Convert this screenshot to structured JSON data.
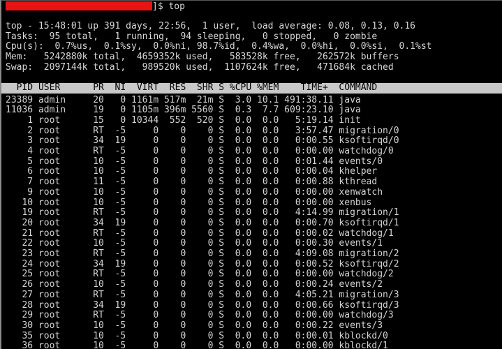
{
  "terminal": {
    "window_title": "top",
    "background_color": "#000000",
    "foreground_color": "#d8d8d8",
    "redaction_color": "#e81313",
    "header_background": "#c8c8c8",
    "header_foreground": "#000000"
  },
  "prompt": {
    "redacted_label": "redacted-prompt",
    "tail": "]$ ",
    "command": "top"
  },
  "summary": {
    "uptime_line": "top - 15:48:01 up 391 days, 22:56,  1 user,  load average: 0.08, 0.13, 0.16",
    "tasks_line": "Tasks:  95 total,   1 running,  94 sleeping,   0 stopped,   0 zombie",
    "cpu_line": "Cpu(s):  0.7%us,  0.1%sy,  0.0%ni, 98.7%id,  0.4%wa,  0.0%hi,  0.0%si,  0.1%st",
    "mem_line": "Mem:   5242880k total,  4659352k used,   583528k free,   262572k buffers",
    "swap_line": "Swap:  2097144k total,   989520k used,  1107624k free,   471684k cached",
    "time": "15:48:01",
    "up_days": "391",
    "up_hm": "22:56",
    "users": "1",
    "load_average": [
      "0.08",
      "0.13",
      "0.16"
    ],
    "tasks": {
      "total": "95",
      "running": "1",
      "sleeping": "94",
      "stopped": "0",
      "zombie": "0"
    },
    "cpu": {
      "us": "0.7",
      "sy": "0.1",
      "ni": "0.0",
      "id": "98.7",
      "wa": "0.4",
      "hi": "0.0",
      "si": "0.0",
      "st": "0.1"
    },
    "mem": {
      "total": "5242880k",
      "used": "4659352k",
      "free": "583528k",
      "buffers": "262572k"
    },
    "swap": {
      "total": "2097144k",
      "used": "989520k",
      "free": "1107624k",
      "cached": "471684k"
    }
  },
  "table": {
    "header_line": "  PID USER      PR  NI  VIRT  RES  SHR S %CPU %MEM    TIME+  COMMAND",
    "columns": [
      "PID",
      "USER",
      "PR",
      "NI",
      "VIRT",
      "RES",
      "SHR",
      "S",
      "%CPU",
      "%MEM",
      "TIME+",
      "COMMAND"
    ],
    "rows": [
      "23389 admin     20   0 1161m 517m  21m S  3.0 10.1 491:38.11 java",
      "11036 admin     19   0 1105m 396m 5560 S  0.3  7.7 609:23.10 java",
      "    1 root      15   0 10344  552  520 S  0.0  0.0   5:19.14 init",
      "    2 root      RT  -5     0    0    0 S  0.0  0.0   3:57.47 migration/0",
      "    3 root      34  19     0    0    0 S  0.0  0.0   0:00.55 ksoftirqd/0",
      "    4 root      RT  -5     0    0    0 S  0.0  0.0   0:00.00 watchdog/0",
      "    5 root      10  -5     0    0    0 S  0.0  0.0   0:01.44 events/0",
      "    6 root      10  -5     0    0    0 S  0.0  0.0   0:00.04 khelper",
      "    7 root      11  -5     0    0    0 S  0.0  0.0   0:00.88 kthread",
      "    9 root      10  -5     0    0    0 S  0.0  0.0   0:00.00 xenwatch",
      "   10 root      10  -5     0    0    0 S  0.0  0.0   0:00.00 xenbus",
      "   19 root      RT  -5     0    0    0 S  0.0  0.0   4:14.99 migration/1",
      "   20 root      34  19     0    0    0 S  0.0  0.0   0:00.70 ksoftirqd/1",
      "   21 root      RT  -5     0    0    0 S  0.0  0.0   0:00.02 watchdog/1",
      "   22 root      10  -5     0    0    0 S  0.0  0.0   0:00.30 events/1",
      "   23 root      RT  -5     0    0    0 S  0.0  0.0   4:09.08 migration/2",
      "   24 root      34  19     0    0    0 S  0.0  0.0   0:00.52 ksoftirqd/2",
      "   25 root      RT  -5     0    0    0 S  0.0  0.0   0:00.00 watchdog/2",
      "   26 root      10  -5     0    0    0 S  0.0  0.0   0:00.24 events/2",
      "   27 root      RT  -5     0    0    0 S  0.0  0.0   4:05.21 migration/3",
      "   28 root      34  19     0    0    0 S  0.0  0.0   0:00.66 ksoftirqd/3",
      "   29 root      RT  -5     0    0    0 S  0.0  0.0   0:00.00 watchdog/3",
      "   30 root      10  -5     0    0    0 S  0.0  0.0   0:00.22 events/3",
      "   35 root      10  -5     0    0    0 S  0.0  0.0   0:00.01 kblockd/0",
      "   36 root      10  -5     0    0    0 S  0.0  0.0   0:00.00 kblockd/1"
    ],
    "processes": [
      {
        "pid": "23389",
        "user": "admin",
        "pr": "20",
        "ni": "0",
        "virt": "1161m",
        "res": "517m",
        "shr": "21m",
        "s": "S",
        "cpu": "3.0",
        "mem": "10.1",
        "time": "491:38.11",
        "command": "java"
      },
      {
        "pid": "11036",
        "user": "admin",
        "pr": "19",
        "ni": "0",
        "virt": "1105m",
        "res": "396m",
        "shr": "5560",
        "s": "S",
        "cpu": "0.3",
        "mem": "7.7",
        "time": "609:23.10",
        "command": "java"
      },
      {
        "pid": "1",
        "user": "root",
        "pr": "15",
        "ni": "0",
        "virt": "10344",
        "res": "552",
        "shr": "520",
        "s": "S",
        "cpu": "0.0",
        "mem": "0.0",
        "time": "5:19.14",
        "command": "init"
      },
      {
        "pid": "2",
        "user": "root",
        "pr": "RT",
        "ni": "-5",
        "virt": "0",
        "res": "0",
        "shr": "0",
        "s": "S",
        "cpu": "0.0",
        "mem": "0.0",
        "time": "3:57.47",
        "command": "migration/0"
      },
      {
        "pid": "3",
        "user": "root",
        "pr": "34",
        "ni": "19",
        "virt": "0",
        "res": "0",
        "shr": "0",
        "s": "S",
        "cpu": "0.0",
        "mem": "0.0",
        "time": "0:00.55",
        "command": "ksoftirqd/0"
      },
      {
        "pid": "4",
        "user": "root",
        "pr": "RT",
        "ni": "-5",
        "virt": "0",
        "res": "0",
        "shr": "0",
        "s": "S",
        "cpu": "0.0",
        "mem": "0.0",
        "time": "0:00.00",
        "command": "watchdog/0"
      },
      {
        "pid": "5",
        "user": "root",
        "pr": "10",
        "ni": "-5",
        "virt": "0",
        "res": "0",
        "shr": "0",
        "s": "S",
        "cpu": "0.0",
        "mem": "0.0",
        "time": "0:01.44",
        "command": "events/0"
      },
      {
        "pid": "6",
        "user": "root",
        "pr": "10",
        "ni": "-5",
        "virt": "0",
        "res": "0",
        "shr": "0",
        "s": "S",
        "cpu": "0.0",
        "mem": "0.0",
        "time": "0:00.04",
        "command": "khelper"
      },
      {
        "pid": "7",
        "user": "root",
        "pr": "11",
        "ni": "-5",
        "virt": "0",
        "res": "0",
        "shr": "0",
        "s": "S",
        "cpu": "0.0",
        "mem": "0.0",
        "time": "0:00.88",
        "command": "kthread"
      },
      {
        "pid": "9",
        "user": "root",
        "pr": "10",
        "ni": "-5",
        "virt": "0",
        "res": "0",
        "shr": "0",
        "s": "S",
        "cpu": "0.0",
        "mem": "0.0",
        "time": "0:00.00",
        "command": "xenwatch"
      },
      {
        "pid": "10",
        "user": "root",
        "pr": "10",
        "ni": "-5",
        "virt": "0",
        "res": "0",
        "shr": "0",
        "s": "S",
        "cpu": "0.0",
        "mem": "0.0",
        "time": "0:00.00",
        "command": "xenbus"
      },
      {
        "pid": "19",
        "user": "root",
        "pr": "RT",
        "ni": "-5",
        "virt": "0",
        "res": "0",
        "shr": "0",
        "s": "S",
        "cpu": "0.0",
        "mem": "0.0",
        "time": "4:14.99",
        "command": "migration/1"
      },
      {
        "pid": "20",
        "user": "root",
        "pr": "34",
        "ni": "19",
        "virt": "0",
        "res": "0",
        "shr": "0",
        "s": "S",
        "cpu": "0.0",
        "mem": "0.0",
        "time": "0:00.70",
        "command": "ksoftirqd/1"
      },
      {
        "pid": "21",
        "user": "root",
        "pr": "RT",
        "ni": "-5",
        "virt": "0",
        "res": "0",
        "shr": "0",
        "s": "S",
        "cpu": "0.0",
        "mem": "0.0",
        "time": "0:00.02",
        "command": "watchdog/1"
      },
      {
        "pid": "22",
        "user": "root",
        "pr": "10",
        "ni": "-5",
        "virt": "0",
        "res": "0",
        "shr": "0",
        "s": "S",
        "cpu": "0.0",
        "mem": "0.0",
        "time": "0:00.30",
        "command": "events/1"
      },
      {
        "pid": "23",
        "user": "root",
        "pr": "RT",
        "ni": "-5",
        "virt": "0",
        "res": "0",
        "shr": "0",
        "s": "S",
        "cpu": "0.0",
        "mem": "0.0",
        "time": "4:09.08",
        "command": "migration/2"
      },
      {
        "pid": "24",
        "user": "root",
        "pr": "34",
        "ni": "19",
        "virt": "0",
        "res": "0",
        "shr": "0",
        "s": "S",
        "cpu": "0.0",
        "mem": "0.0",
        "time": "0:00.52",
        "command": "ksoftirqd/2"
      },
      {
        "pid": "25",
        "user": "root",
        "pr": "RT",
        "ni": "-5",
        "virt": "0",
        "res": "0",
        "shr": "0",
        "s": "S",
        "cpu": "0.0",
        "mem": "0.0",
        "time": "0:00.00",
        "command": "watchdog/2"
      },
      {
        "pid": "26",
        "user": "root",
        "pr": "10",
        "ni": "-5",
        "virt": "0",
        "res": "0",
        "shr": "0",
        "s": "S",
        "cpu": "0.0",
        "mem": "0.0",
        "time": "0:00.24",
        "command": "events/2"
      },
      {
        "pid": "27",
        "user": "root",
        "pr": "RT",
        "ni": "-5",
        "virt": "0",
        "res": "0",
        "shr": "0",
        "s": "S",
        "cpu": "0.0",
        "mem": "0.0",
        "time": "4:05.21",
        "command": "migration/3"
      },
      {
        "pid": "28",
        "user": "root",
        "pr": "34",
        "ni": "19",
        "virt": "0",
        "res": "0",
        "shr": "0",
        "s": "S",
        "cpu": "0.0",
        "mem": "0.0",
        "time": "0:00.66",
        "command": "ksoftirqd/3"
      },
      {
        "pid": "29",
        "user": "root",
        "pr": "RT",
        "ni": "-5",
        "virt": "0",
        "res": "0",
        "shr": "0",
        "s": "S",
        "cpu": "0.0",
        "mem": "0.0",
        "time": "0:00.00",
        "command": "watchdog/3"
      },
      {
        "pid": "30",
        "user": "root",
        "pr": "10",
        "ni": "-5",
        "virt": "0",
        "res": "0",
        "shr": "0",
        "s": "S",
        "cpu": "0.0",
        "mem": "0.0",
        "time": "0:00.22",
        "command": "events/3"
      },
      {
        "pid": "35",
        "user": "root",
        "pr": "10",
        "ni": "-5",
        "virt": "0",
        "res": "0",
        "shr": "0",
        "s": "S",
        "cpu": "0.0",
        "mem": "0.0",
        "time": "0:00.01",
        "command": "kblockd/0"
      },
      {
        "pid": "36",
        "user": "root",
        "pr": "10",
        "ni": "-5",
        "virt": "0",
        "res": "0",
        "shr": "0",
        "s": "S",
        "cpu": "0.0",
        "mem": "0.0",
        "time": "0:00.00",
        "command": "kblockd/1"
      }
    ]
  }
}
